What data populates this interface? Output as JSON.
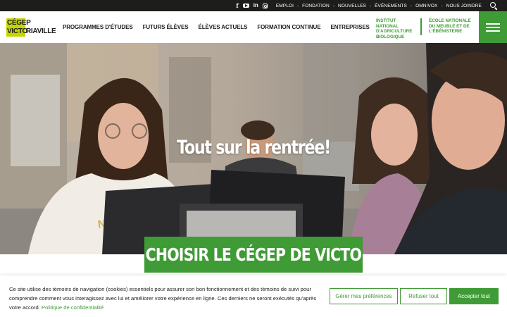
{
  "topbar": {
    "social": [
      "facebook-icon",
      "youtube-icon",
      "linkedin-icon",
      "instagram-icon"
    ],
    "links": [
      "EMPLOI",
      "FONDATION",
      "NOUVELLES",
      "ÉVÉNEMENTS",
      "OMNIVOX",
      "NOUS JOINDRE"
    ],
    "separator": "-"
  },
  "logo": {
    "line1": "CÉGEP",
    "line2": "VICTO",
    "line3": "RIAVILLE"
  },
  "nav": {
    "items": [
      "PROGRAMMES D'ÉTUDES",
      "FUTURS ÉLÈVES",
      "ÉLÈVES ACTUELS",
      "FORMATION CONTINUE",
      "ENTREPRISES"
    ]
  },
  "institutes": {
    "inst1": "INSTITUT NATIONAL D'AGRICULTURE BIOLOGIQUE",
    "inst2": "ÉCOLE NATIONALE DU MEUBLE ET DE L'ÉBÉNISTERIE"
  },
  "hero": {
    "title": "Tout sur la rentrée!",
    "cta": "CHOISIR LE CÉGEP DE VICTO"
  },
  "cookie": {
    "text": "Ce site utilise des témoins de navigation (cookies) essentiels pour assurer son bon fonctionnement et des témoins de suivi pour comprendre comment vous interagissez avec lui et améliorer votre expérience en ligne. Ces derniers ne seront exécutés qu'après votre accord.",
    "policy_link": "Politique de confidentialité",
    "btn_prefs": "Gérer mes préférences",
    "btn_refuse": "Refuser tout",
    "btn_accept": "Accepter tout"
  },
  "colors": {
    "brand_green": "#3f9b35",
    "logo_lime": "#c4d600",
    "topbar": "#1d1d1b"
  }
}
